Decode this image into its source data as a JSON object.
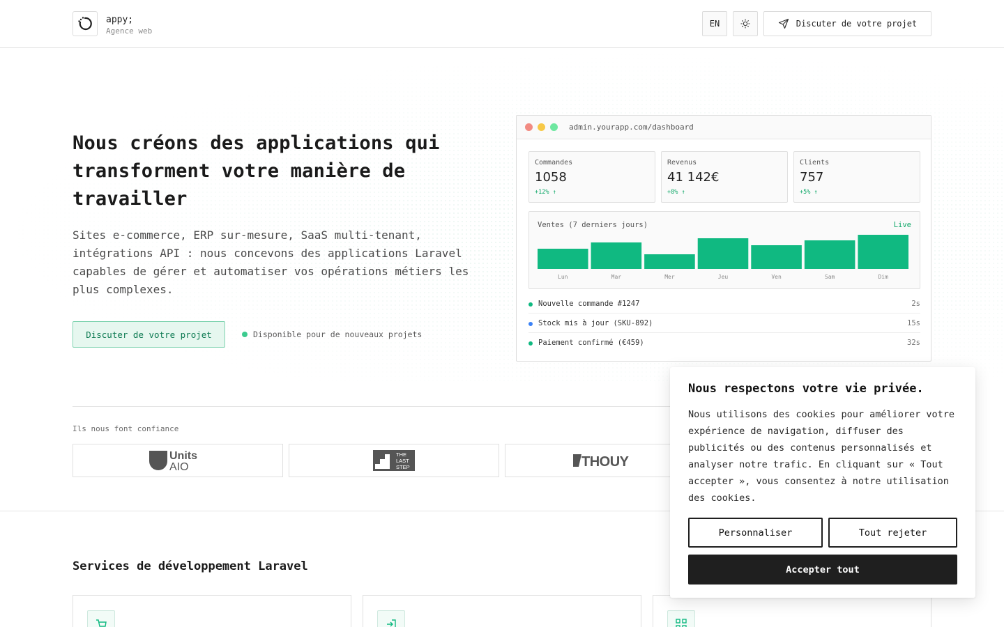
{
  "header": {
    "brand": "appy;",
    "tagline": "Agence web",
    "lang": "EN",
    "cta": "Discuter de votre projet"
  },
  "hero": {
    "title": "Nous créons des applications qui transforment votre manière de travailler",
    "description": "Sites e-commerce, ERP sur-mesure, SaaS multi-tenant, intégrations API : nous concevons des applications Laravel capables de gérer et automatiser vos opérations métiers les plus complexes.",
    "cta": "Discuter de votre projet",
    "availability": "Disponible pour de nouveaux projets"
  },
  "dashboard": {
    "url": "admin.yourapp.com/dashboard",
    "stats": [
      {
        "label": "Commandes",
        "value": "1058",
        "delta": "+12% ↑"
      },
      {
        "label": "Revenus",
        "value": "41 142€",
        "delta": "+8% ↑"
      },
      {
        "label": "Clients",
        "value": "757",
        "delta": "+5% ↑"
      }
    ],
    "chart_title": "Ventes (7 derniers jours)",
    "chart_status": "Live",
    "activity": [
      {
        "text": "Nouvelle commande #1247",
        "time": "2s",
        "color": "#10b981"
      },
      {
        "text": "Stock mis à jour (SKU-892)",
        "time": "15s",
        "color": "#3b82f6"
      },
      {
        "text": "Paiement confirmé (€459)",
        "time": "32s",
        "color": "#10b981"
      }
    ]
  },
  "chart_data": {
    "type": "bar",
    "title": "Ventes (7 derniers jours)",
    "categories": [
      "Lun",
      "Mar",
      "Mer",
      "Jeu",
      "Ven",
      "Sam",
      "Dim"
    ],
    "values": [
      58,
      76,
      42,
      88,
      68,
      82,
      98
    ],
    "ylim": [
      0,
      100
    ],
    "color": "#10b981"
  },
  "trust": {
    "label": "Ils nous font confiance",
    "logos": [
      {
        "top": "Units",
        "bottom": "AIO"
      },
      {
        "text": "THE LAST STEP"
      },
      {
        "text": "THOUY"
      }
    ]
  },
  "services": {
    "title": "Services de développement Laravel"
  },
  "cookie": {
    "title": "Nous respectons votre vie privée.",
    "text": "Nous utilisons des cookies pour améliorer votre expérience de navigation, diffuser des publicités ou des contenus personnalisés et analyser notre trafic. En cliquant sur « Tout accepter », vous consentez à notre utilisation des cookies.",
    "customize": "Personnaliser",
    "reject": "Tout rejeter",
    "accept": "Accepter tout"
  },
  "colors": {
    "accent": "#10b981",
    "accent_dark": "#0d7a52",
    "info": "#3b82f6"
  }
}
